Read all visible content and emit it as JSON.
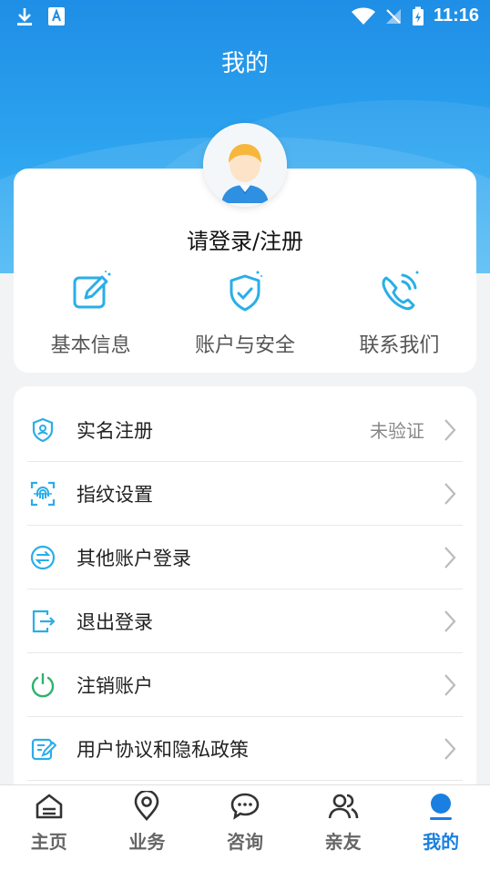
{
  "status_bar": {
    "time": "11:16"
  },
  "header": {
    "title": "我的"
  },
  "profile": {
    "login_prompt": "请登录/注册",
    "quick_actions": [
      {
        "label": "基本信息",
        "icon": "edit-icon"
      },
      {
        "label": "账户与安全",
        "icon": "shield-check-icon"
      },
      {
        "label": "联系我们",
        "icon": "phone-icon"
      }
    ]
  },
  "menu": {
    "items": [
      {
        "label": "实名注册",
        "status": "未验证",
        "icon": "id-shield-icon"
      },
      {
        "label": "指纹设置",
        "status": "",
        "icon": "fingerprint-icon"
      },
      {
        "label": "其他账户登录",
        "status": "",
        "icon": "switch-account-icon"
      },
      {
        "label": "退出登录",
        "status": "",
        "icon": "logout-icon"
      },
      {
        "label": "注销账户",
        "status": "",
        "icon": "power-icon"
      },
      {
        "label": "用户协议和隐私政策",
        "status": "",
        "icon": "agreement-icon"
      }
    ]
  },
  "tabs": [
    {
      "label": "主页",
      "icon": "home-icon"
    },
    {
      "label": "业务",
      "icon": "location-icon"
    },
    {
      "label": "咨询",
      "icon": "chat-icon"
    },
    {
      "label": "亲友",
      "icon": "friends-icon"
    },
    {
      "label": "我的",
      "icon": "profile-icon",
      "active": true
    }
  ],
  "colors": {
    "accent": "#1a7fe0",
    "header": "#2ea6f0",
    "icon_blue": "#2aaee8",
    "icon_green": "#2db36b"
  }
}
